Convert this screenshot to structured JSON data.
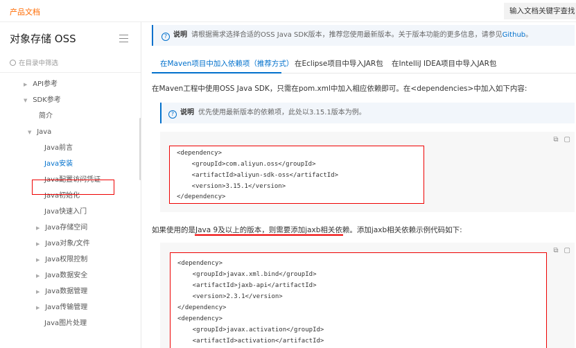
{
  "header": {
    "brand": "产品文档",
    "search_label": "输入文档关键字查找"
  },
  "sidebar": {
    "title": "对象存储 OSS",
    "filter_placeholder": "在目录中筛选",
    "items": [
      {
        "label": "API参考",
        "arrow": "▶"
      },
      {
        "label": "SDK参考",
        "arrow": "▼"
      },
      {
        "label": "简介",
        "arrow": ""
      },
      {
        "label": "Java",
        "arrow": "▼"
      },
      {
        "label": "Java前言",
        "arrow": ""
      },
      {
        "label": "Java安装",
        "arrow": ""
      },
      {
        "label": "Java配置访问凭证",
        "arrow": ""
      },
      {
        "label": "Java初始化",
        "arrow": ""
      },
      {
        "label": "Java快速入门",
        "arrow": ""
      },
      {
        "label": "Java存储空间",
        "arrow": "▶"
      },
      {
        "label": "Java对象/文件",
        "arrow": "▶"
      },
      {
        "label": "Java权限控制",
        "arrow": "▶"
      },
      {
        "label": "Java数据安全",
        "arrow": "▶"
      },
      {
        "label": "Java数据管理",
        "arrow": "▶"
      },
      {
        "label": "Java传输管理",
        "arrow": "▶"
      },
      {
        "label": "Java图片处理",
        "arrow": ""
      }
    ]
  },
  "main": {
    "top_note": {
      "icon": "?",
      "label": "说明",
      "text": "请根据需求选择合适的OSS Java SDK版本，推荐您使用最新版本。关于版本功能的更多信息，请参见",
      "link": "Github",
      "end": "。"
    },
    "tabs": [
      "在Maven项目中加入依赖项（推荐方式）",
      "在Eclipse项目中导入JAR包",
      "在IntelliJ IDEA项目中导入JAR包"
    ],
    "para1": "在Maven工程中使用OSS Java SDK，只需在pom.xml中加入相应依赖即可。在<dependencies>中加入如下内容:",
    "note2": {
      "icon": "?",
      "label": "说明",
      "text": "优先使用最新版本的依赖项，此处以3.15.1版本为例。"
    },
    "code1": [
      "<dependency>",
      "    <groupId>com.aliyun.oss</groupId>",
      "    <artifactId>aliyun-sdk-oss</artifactId>",
      "    <version>3.15.1</version>",
      "</dependency>"
    ],
    "para2": "如果使用的是Java 9及以上的版本，则需要添加jaxb相关依赖。添加jaxb相关依赖示例代码如下:",
    "code2": [
      "<dependency>",
      "    <groupId>javax.xml.bind</groupId>",
      "    <artifactId>jaxb-api</artifactId>",
      "    <version>2.3.1</version>",
      "</dependency>",
      "<dependency>",
      "    <groupId>javax.activation</groupId>",
      "    <artifactId>activation</artifactId>"
    ],
    "code_tools": [
      "⧉",
      "▢"
    ]
  },
  "colors": {
    "accent": "#0070cc",
    "brand": "#ff6a00",
    "highlight": "#ee0000"
  }
}
